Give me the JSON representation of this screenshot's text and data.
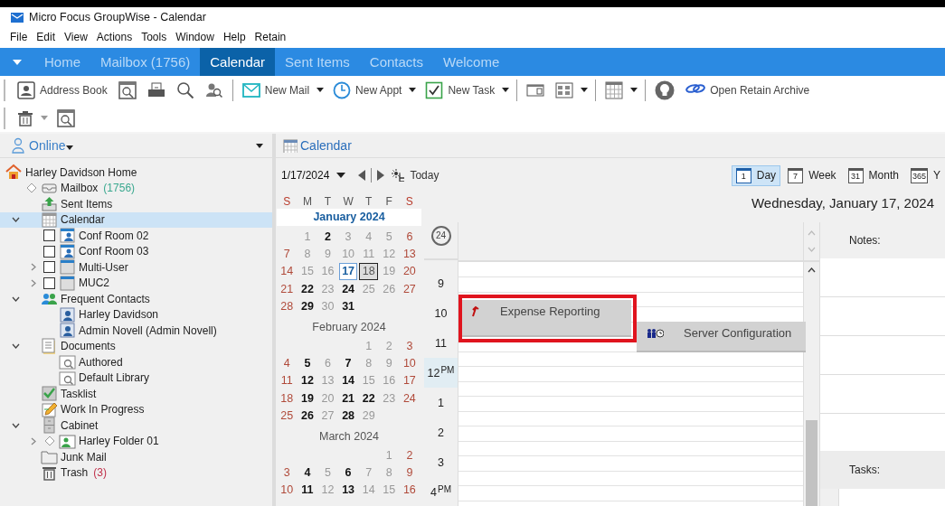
{
  "window": {
    "title": "Micro Focus GroupWise - Calendar"
  },
  "menu": [
    "File",
    "Edit",
    "View",
    "Actions",
    "Tools",
    "Window",
    "Help",
    "Retain"
  ],
  "nav_tabs": [
    {
      "label": "Home",
      "selected": false
    },
    {
      "label": "Mailbox (1756)",
      "selected": false
    },
    {
      "label": "Calendar",
      "selected": true
    },
    {
      "label": "Sent Items",
      "selected": false
    },
    {
      "label": "Contacts",
      "selected": false
    },
    {
      "label": "Welcome",
      "selected": false
    }
  ],
  "toolbar": [
    [
      {
        "kind": "button",
        "label": "Address Book",
        "has_menu": false
      },
      {
        "kind": "button",
        "has_menu": false
      },
      {
        "kind": "button",
        "has_menu": false
      },
      {
        "kind": "button",
        "has_menu": false
      },
      {
        "kind": "button",
        "has_menu": false
      },
      {
        "kind": "separator"
      },
      {
        "kind": "button",
        "label": "New Mail",
        "has_menu": true
      },
      {
        "kind": "button",
        "label": "New Appt",
        "has_menu": true
      },
      {
        "kind": "button",
        "label": "New Task",
        "has_menu": true
      },
      {
        "kind": "separator"
      },
      {
        "kind": "button",
        "has_menu": false
      },
      {
        "kind": "button",
        "has_menu": true
      },
      {
        "kind": "separator"
      },
      {
        "kind": "button",
        "has_menu": true
      },
      {
        "kind": "separator"
      },
      {
        "kind": "button",
        "has_menu": false
      },
      {
        "kind": "button",
        "label": "Open Retain Archive",
        "has_menu": false
      }
    ],
    [
      {
        "kind": "button",
        "has_menu": true
      },
      {
        "kind": "button",
        "has_menu": false
      }
    ]
  ],
  "sidebar": {
    "title": "Online",
    "tree": [
      {
        "label": "Harley Davidson Home",
        "kind": "home",
        "selected": false,
        "children": [
          {
            "label": "Mailbox",
            "count": {
              "text": "(1756)",
              "color": "#3aa88f"
            },
            "kind": "mailbox",
            "tagged": true,
            "expandable": false,
            "selected": false
          },
          {
            "label": "Sent Items",
            "kind": "sent",
            "expandable": false,
            "selected": false
          },
          {
            "label": "Calendar",
            "kind": "calendar",
            "expandable": true,
            "expanded": true,
            "selected": true,
            "children": [
              {
                "label": "Conf Room 02",
                "kind": "resource",
                "checked": false,
                "expandable": false,
                "selected": false
              },
              {
                "label": "Conf Room 03",
                "kind": "resource",
                "checked": false,
                "expandable": false,
                "selected": false
              },
              {
                "label": "Multi-User",
                "kind": "shared",
                "checked": false,
                "expandable": true,
                "expanded": false,
                "selected": false
              },
              {
                "label": "MUC2",
                "kind": "shared",
                "checked": false,
                "expandable": true,
                "expanded": false,
                "selected": false
              }
            ]
          },
          {
            "label": "Frequent Contacts",
            "kind": "contacts",
            "expandable": true,
            "expanded": true,
            "selected": false,
            "children": [
              {
                "label": "Harley Davidson",
                "kind": "contact",
                "expandable": false,
                "selected": false
              },
              {
                "label": "Admin Novell (Admin Novell)",
                "kind": "contact",
                "expandable": false,
                "selected": false
              }
            ]
          },
          {
            "label": "Documents",
            "kind": "documents",
            "expandable": true,
            "expanded": true,
            "selected": false,
            "children": [
              {
                "label": "Authored",
                "kind": "library",
                "expandable": false,
                "selected": false
              },
              {
                "label": "Default Library",
                "kind": "library",
                "expandable": false,
                "selected": false
              }
            ]
          },
          {
            "label": "Tasklist",
            "kind": "tasklist",
            "expandable": false,
            "selected": false
          },
          {
            "label": "Work In Progress",
            "kind": "work",
            "expandable": false,
            "selected": false
          },
          {
            "label": "Cabinet",
            "kind": "cabinet",
            "expandable": true,
            "expanded": true,
            "selected": false,
            "children": [
              {
                "label": "Harley Folder 01",
                "kind": "folder",
                "tagged": true,
                "expandable": true,
                "expanded": false,
                "selected": false
              }
            ]
          },
          {
            "label": "Junk Mail",
            "kind": "junk",
            "expandable": false,
            "selected": false
          },
          {
            "label": "Trash",
            "count": {
              "text": "(3)",
              "color": "#c0304a"
            },
            "kind": "trash",
            "expandable": false,
            "selected": false
          }
        ]
      }
    ]
  },
  "calendar": {
    "title": "Calendar",
    "date_field": "1/17/2024",
    "today_button": "Today",
    "views": [
      {
        "badge": "1",
        "label": "Day",
        "selected": true
      },
      {
        "badge": "7",
        "label": "Week",
        "selected": false
      },
      {
        "badge": "31",
        "label": "Month",
        "selected": false
      },
      {
        "badge": "365",
        "label": "Y",
        "selected": false
      }
    ],
    "weekdays": [
      "S",
      "M",
      "T",
      "W",
      "T",
      "F",
      "S"
    ],
    "months": [
      {
        "title": "January 2024",
        "selected": true,
        "weeks": [
          [
            {
              "day": "1",
              "bold": false,
              "today": false,
              "selected": false
            },
            {
              "day": "2",
              "bold": true,
              "today": false,
              "selected": false
            },
            {
              "day": "3",
              "bold": false,
              "today": false,
              "selected": false
            },
            {
              "day": "4",
              "bold": false,
              "today": false,
              "selected": false
            },
            {
              "day": "5",
              "bold": false,
              "today": false,
              "selected": false
            },
            {
              "day": "6",
              "bold": false,
              "today": false,
              "selected": false
            }
          ],
          [
            {
              "day": "7",
              "bold": false,
              "today": false,
              "selected": false
            },
            {
              "day": "8",
              "bold": false,
              "today": false,
              "selected": false
            },
            {
              "day": "9",
              "bold": false,
              "today": false,
              "selected": false
            },
            {
              "day": "10",
              "bold": false,
              "today": false,
              "selected": false
            },
            {
              "day": "11",
              "bold": false,
              "today": false,
              "selected": false
            },
            {
              "day": "12",
              "bold": false,
              "today": false,
              "selected": false
            },
            {
              "day": "13",
              "bold": false,
              "today": false,
              "selected": false
            }
          ],
          [
            {
              "day": "14",
              "bold": false,
              "today": false,
              "selected": false
            },
            {
              "day": "15",
              "bold": false,
              "today": false,
              "selected": false
            },
            {
              "day": "16",
              "bold": false,
              "today": false,
              "selected": false
            },
            {
              "day": "17",
              "bold": true,
              "today": true,
              "selected": false
            },
            {
              "day": "18",
              "bold": false,
              "today": false,
              "selected": true
            },
            {
              "day": "19",
              "bold": false,
              "today": false,
              "selected": false
            },
            {
              "day": "20",
              "bold": false,
              "today": false,
              "selected": false
            }
          ],
          [
            {
              "day": "21",
              "bold": false,
              "today": false,
              "selected": false
            },
            {
              "day": "22",
              "bold": true,
              "today": false,
              "selected": false
            },
            {
              "day": "23",
              "bold": false,
              "today": false,
              "selected": false
            },
            {
              "day": "24",
              "bold": true,
              "today": false,
              "selected": false
            },
            {
              "day": "25",
              "bold": false,
              "today": false,
              "selected": false
            },
            {
              "day": "26",
              "bold": false,
              "today": false,
              "selected": false
            },
            {
              "day": "27",
              "bold": false,
              "today": false,
              "selected": false
            }
          ],
          [
            {
              "day": "28",
              "bold": false,
              "today": false,
              "selected": false
            },
            {
              "day": "29",
              "bold": true,
              "today": false,
              "selected": false
            },
            {
              "day": "30",
              "bold": false,
              "today": false,
              "selected": false
            },
            {
              "day": "31",
              "bold": true,
              "today": false,
              "selected": false
            }
          ]
        ]
      },
      {
        "title": "February 2024",
        "selected": false,
        "weeks": [
          [
            {
              "day": "1",
              "bold": false,
              "today": false,
              "selected": false
            },
            {
              "day": "2",
              "bold": false,
              "today": false,
              "selected": false
            },
            {
              "day": "3",
              "bold": false,
              "today": false,
              "selected": false
            }
          ],
          [
            {
              "day": "4",
              "bold": false,
              "today": false,
              "selected": false
            },
            {
              "day": "5",
              "bold": true,
              "today": false,
              "selected": false
            },
            {
              "day": "6",
              "bold": false,
              "today": false,
              "selected": false
            },
            {
              "day": "7",
              "bold": true,
              "today": false,
              "selected": false
            },
            {
              "day": "8",
              "bold": false,
              "today": false,
              "selected": false
            },
            {
              "day": "9",
              "bold": false,
              "today": false,
              "selected": false
            },
            {
              "day": "10",
              "bold": false,
              "today": false,
              "selected": false
            }
          ],
          [
            {
              "day": "11",
              "bold": false,
              "today": false,
              "selected": false
            },
            {
              "day": "12",
              "bold": true,
              "today": false,
              "selected": false
            },
            {
              "day": "13",
              "bold": false,
              "today": false,
              "selected": false
            },
            {
              "day": "14",
              "bold": true,
              "today": false,
              "selected": false
            },
            {
              "day": "15",
              "bold": false,
              "today": false,
              "selected": false
            },
            {
              "day": "16",
              "bold": false,
              "today": false,
              "selected": false
            },
            {
              "day": "17",
              "bold": false,
              "today": false,
              "selected": false
            }
          ],
          [
            {
              "day": "18",
              "bold": false,
              "today": false,
              "selected": false
            },
            {
              "day": "19",
              "bold": true,
              "today": false,
              "selected": false
            },
            {
              "day": "20",
              "bold": false,
              "today": false,
              "selected": false
            },
            {
              "day": "21",
              "bold": true,
              "today": false,
              "selected": false
            },
            {
              "day": "22",
              "bold": true,
              "today": false,
              "selected": false
            },
            {
              "day": "23",
              "bold": false,
              "today": false,
              "selected": false
            },
            {
              "day": "24",
              "bold": false,
              "today": false,
              "selected": false
            }
          ],
          [
            {
              "day": "25",
              "bold": false,
              "today": false,
              "selected": false
            },
            {
              "day": "26",
              "bold": true,
              "today": false,
              "selected": false
            },
            {
              "day": "27",
              "bold": false,
              "today": false,
              "selected": false
            },
            {
              "day": "28",
              "bold": true,
              "today": false,
              "selected": false
            },
            {
              "day": "29",
              "bold": false,
              "today": false,
              "selected": false
            }
          ]
        ]
      },
      {
        "title": "March 2024",
        "selected": false,
        "weeks": [
          [
            {
              "day": "1",
              "bold": false,
              "today": false,
              "selected": false
            },
            {
              "day": "2",
              "bold": false,
              "today": false,
              "selected": false
            }
          ],
          [
            {
              "day": "3",
              "bold": false,
              "today": false,
              "selected": false
            },
            {
              "day": "4",
              "bold": true,
              "today": false,
              "selected": false
            },
            {
              "day": "5",
              "bold": false,
              "today": false,
              "selected": false
            },
            {
              "day": "6",
              "bold": true,
              "today": false,
              "selected": false
            },
            {
              "day": "7",
              "bold": false,
              "today": false,
              "selected": false
            },
            {
              "day": "8",
              "bold": false,
              "today": false,
              "selected": false
            },
            {
              "day": "9",
              "bold": false,
              "today": false,
              "selected": false
            }
          ],
          [
            {
              "day": "10",
              "bold": false,
              "today": false,
              "selected": false
            },
            {
              "day": "11",
              "bold": true,
              "today": false,
              "selected": false
            },
            {
              "day": "12",
              "bold": false,
              "today": false,
              "selected": false
            },
            {
              "day": "13",
              "bold": true,
              "today": false,
              "selected": false
            },
            {
              "day": "14",
              "bold": false,
              "today": false,
              "selected": false
            },
            {
              "day": "15",
              "bold": false,
              "today": false,
              "selected": false
            },
            {
              "day": "16",
              "bold": false,
              "today": false,
              "selected": false
            }
          ]
        ]
      }
    ],
    "day_title": "Wednesday, January 17, 2024",
    "clock_badge": "24",
    "hours": [
      {
        "hour": "9",
        "current": false
      },
      {
        "hour": "10",
        "current": false,
        "appointments": [
          {
            "subject": "Expense Reporting",
            "kind": "posted",
            "highlighted": true
          },
          {
            "subject": "Server Configuration",
            "kind": "group",
            "highlighted": false
          }
        ]
      },
      {
        "hour": "11",
        "current": false
      },
      {
        "hour": "12",
        "suffix": "PM",
        "current": true
      },
      {
        "hour": "1",
        "current": false
      },
      {
        "hour": "2",
        "current": false
      },
      {
        "hour": "3",
        "current": false
      },
      {
        "hour": "4",
        "suffix": "PM",
        "current": false
      }
    ],
    "notes_label": "Notes:",
    "tasks_label": "Tasks:"
  }
}
